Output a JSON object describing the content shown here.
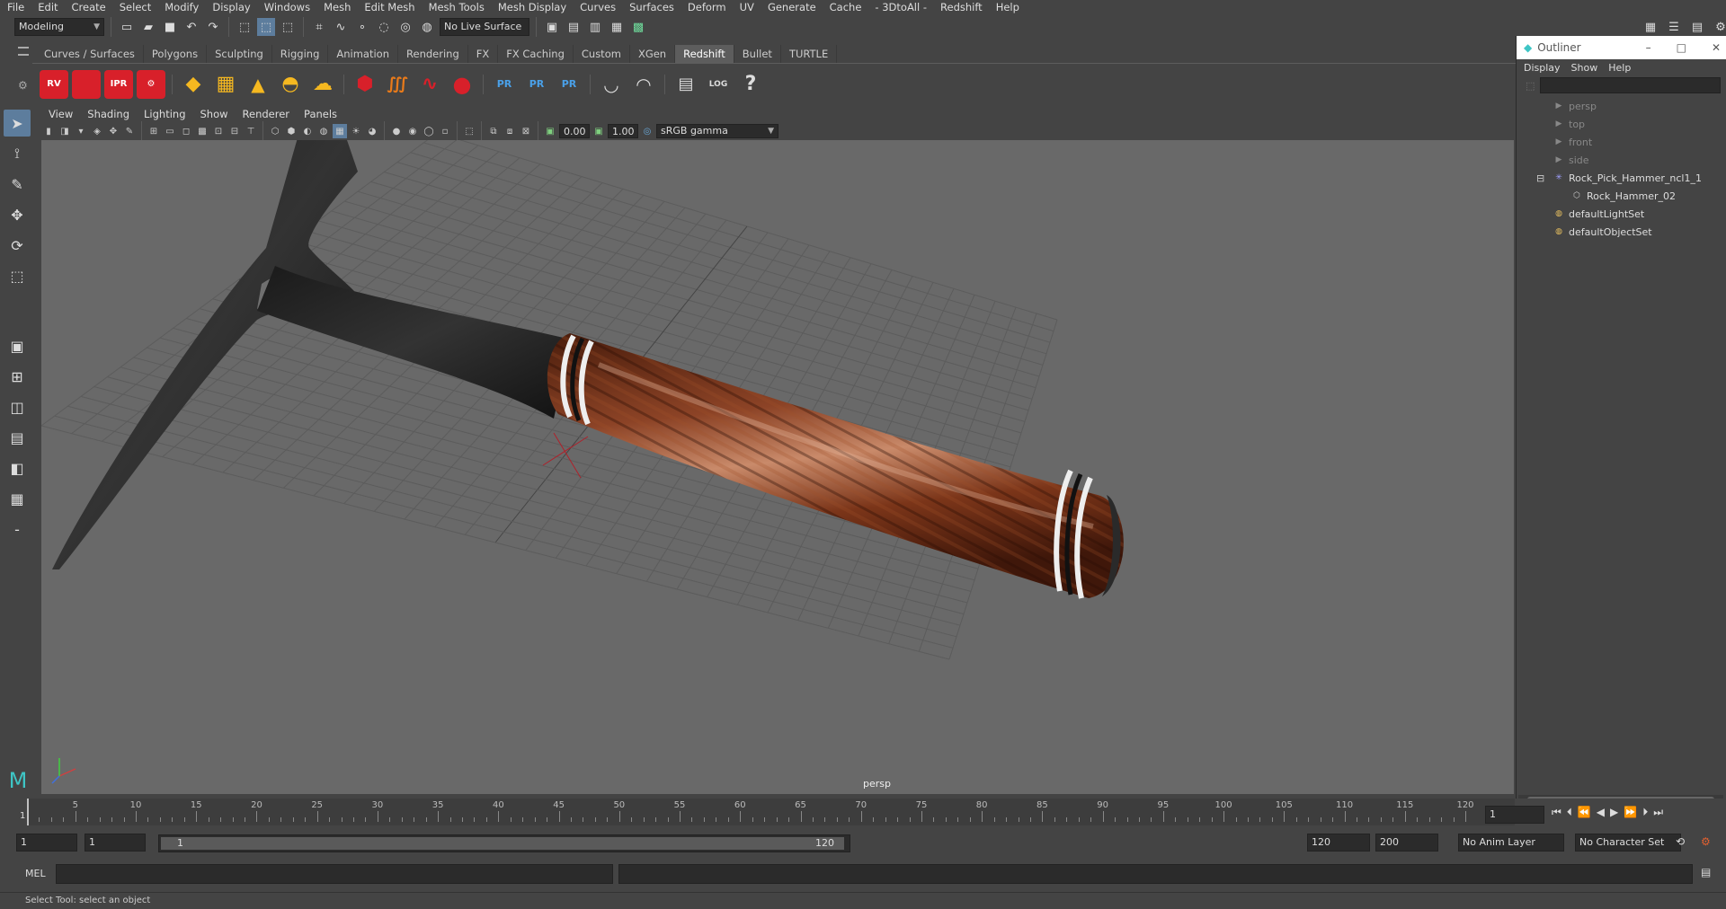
{
  "menubar": {
    "items": [
      "File",
      "Edit",
      "Create",
      "Select",
      "Modify",
      "Display",
      "Windows",
      "Mesh",
      "Edit Mesh",
      "Mesh Tools",
      "Mesh Display",
      "Curves",
      "Surfaces",
      "Deform",
      "UV",
      "Generate",
      "Cache",
      "- 3DtoAll -",
      "Redshift",
      "Help"
    ]
  },
  "statusline": {
    "mode": "Modeling",
    "live_surface": "No Live Surface"
  },
  "shelf": {
    "tabs": [
      "Curves / Surfaces",
      "Polygons",
      "Sculpting",
      "Rigging",
      "Animation",
      "Rendering",
      "FX",
      "FX Caching",
      "Custom",
      "XGen",
      "Redshift",
      "Bullet",
      "TURTLE"
    ],
    "active_tab": "Redshift",
    "icons": [
      "RV",
      "",
      "IPR",
      "",
      "",
      "",
      "",
      "",
      "",
      "",
      "",
      "",
      "",
      "PR",
      "PR",
      "PR",
      "",
      "",
      "",
      "LOG",
      "?"
    ]
  },
  "viewport": {
    "menus": [
      "View",
      "Shading",
      "Lighting",
      "Show",
      "Renderer",
      "Panels"
    ],
    "exposure": "0.00",
    "gamma": "1.00",
    "color_space": "sRGB gamma",
    "camera_label": "persp"
  },
  "outliner": {
    "title": "Outliner",
    "menus": [
      "Display",
      "Show",
      "Help"
    ],
    "rows": [
      {
        "label": "persp",
        "icon": "camera-icon",
        "indent": 1,
        "dim": true
      },
      {
        "label": "top",
        "icon": "camera-icon",
        "indent": 1,
        "dim": true
      },
      {
        "label": "front",
        "icon": "camera-icon",
        "indent": 1,
        "dim": true
      },
      {
        "label": "side",
        "icon": "camera-icon",
        "indent": 1,
        "dim": true
      },
      {
        "label": "Rock_Pick_Hammer_ncl1_1",
        "icon": "group-icon",
        "indent": 1,
        "dim": false
      },
      {
        "label": "Rock_Hammer_02",
        "icon": "mesh-icon",
        "indent": 2,
        "dim": false
      },
      {
        "label": "defaultLightSet",
        "icon": "set-icon",
        "indent": 1,
        "dim": false
      },
      {
        "label": "defaultObjectSet",
        "icon": "set-icon",
        "indent": 1,
        "dim": false
      }
    ]
  },
  "timeslider": {
    "labels": [
      "5",
      "10",
      "15",
      "20",
      "25",
      "30",
      "35",
      "40",
      "45",
      "50",
      "55",
      "60",
      "65",
      "70",
      "75",
      "80",
      "85",
      "90",
      "95",
      "100",
      "105",
      "110",
      "115",
      "120"
    ],
    "start_marker": "1",
    "current_frame": "1"
  },
  "range": {
    "start": "1",
    "playback_start": "1",
    "range_start_label": "1",
    "range_end_label": "120",
    "playback_end": "120",
    "end": "200",
    "anim_layer": "No Anim Layer",
    "character_set": "No Character Set"
  },
  "cmdline": {
    "label": "MEL"
  },
  "helpline": {
    "text": "Select Tool: select an object"
  },
  "colors": {
    "bg": "#444444",
    "viewport": "#696969",
    "active_tab": "#5d5d5d",
    "redshift_red": "#d8202a",
    "leather": "#7a3a1f"
  }
}
